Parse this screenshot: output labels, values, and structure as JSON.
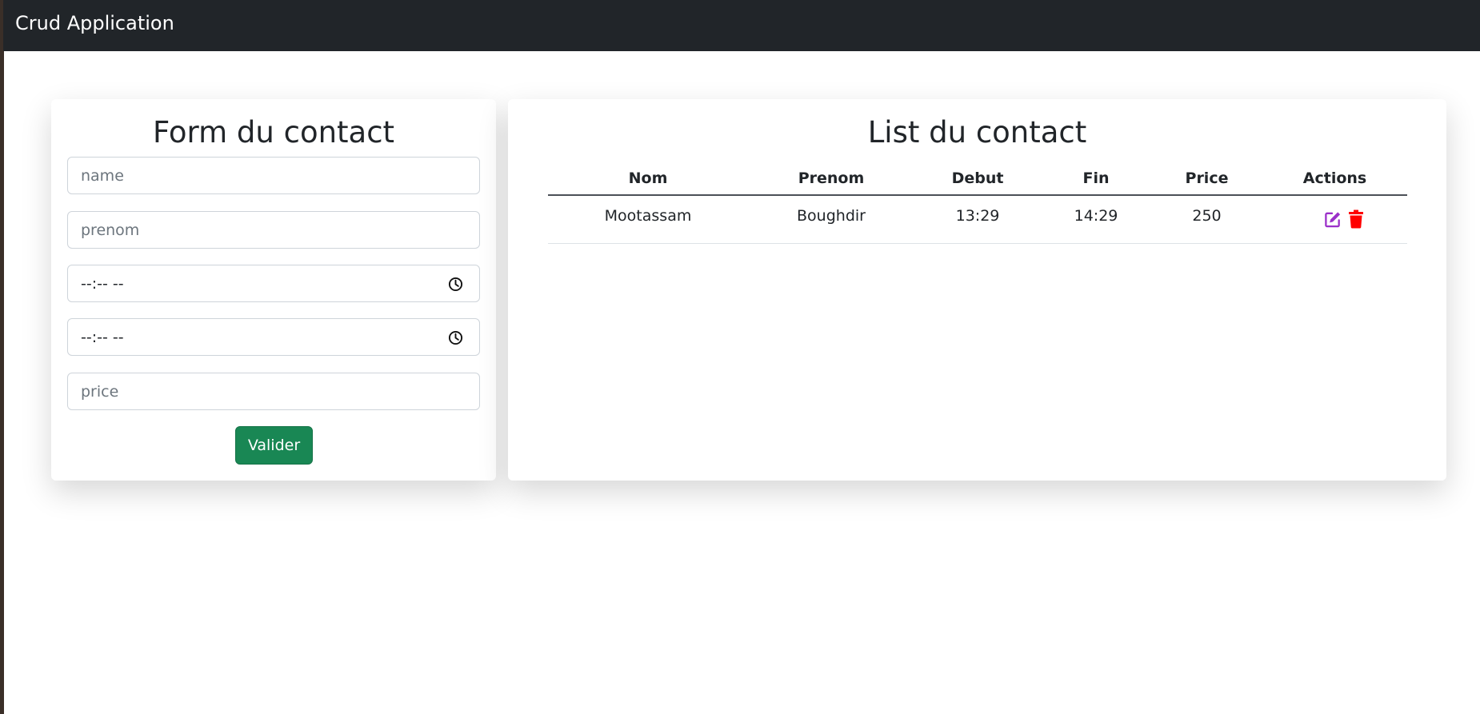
{
  "navbar": {
    "brand": "Crud Application"
  },
  "form": {
    "title": "Form du contact",
    "fields": {
      "name_placeholder": "name",
      "prenom_placeholder": "prenom",
      "debut_value": "--:-- --",
      "fin_value": "--:-- --",
      "price_placeholder": "price"
    },
    "submit_label": "Valider"
  },
  "list": {
    "title": "List du contact",
    "headers": [
      "Nom",
      "Prenom",
      "Debut",
      "Fin",
      "Price",
      "Actions"
    ],
    "rows": [
      {
        "nom": "Mootassam",
        "prenom": "Boughdir",
        "debut": "13:29",
        "fin": "14:29",
        "price": "250"
      }
    ]
  },
  "colors": {
    "navbar_bg": "#212529",
    "submit_bg": "#198754",
    "edit_icon": "#9b30c9",
    "delete_icon": "#ff0000"
  },
  "icons": [
    "clock-icon",
    "edit-icon",
    "trash-icon"
  ]
}
